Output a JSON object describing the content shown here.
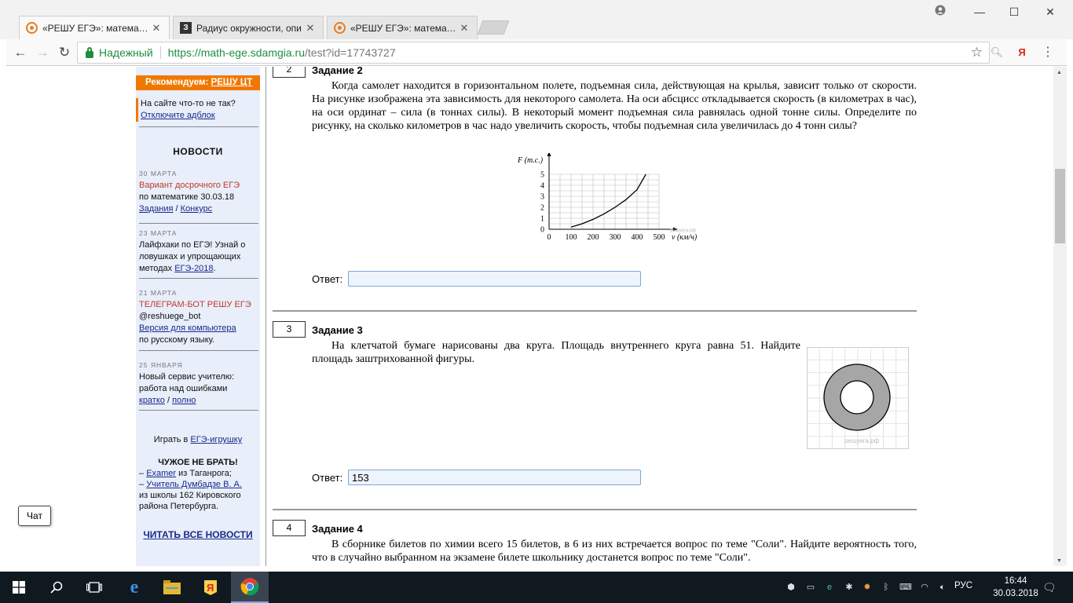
{
  "browser": {
    "tabs": [
      {
        "title": "«РЕШУ ЕГЭ»: математика",
        "favicon": "reshu-ege-icon",
        "active": true
      },
      {
        "title": "Радиус окружности, опи",
        "favicon": "znanija-icon",
        "active": false
      },
      {
        "title": "«РЕШУ ЕГЭ»: математика",
        "favicon": "reshu-ege-icon",
        "active": false
      }
    ],
    "secure_label": "Надежный",
    "url_host": "https://math-ege.sdamgia.ru",
    "url_path": "/test?id=17743727"
  },
  "sidebar": {
    "recommend_prefix": "Рекомендуем:",
    "recommend_link": "РЕШУ ЦТ",
    "problem_text": "На сайте что-то не так?",
    "problem_link": "Отключите адблок",
    "news_title": "НОВОСТИ",
    "news": [
      {
        "date": "30 МАРТА",
        "line1": "Вариант досрочного ЕГЭ",
        "line2": "по математике 30.03.18",
        "link1": "Задания",
        "sep": " / ",
        "link2": "Конкурс"
      },
      {
        "date": "23 МАРТА",
        "line1": "Лайфхаки по ЕГЭ! Узнай о",
        "line2": "ловушках и упрощающих",
        "line3": "методах ",
        "link": "ЕГЭ-2018",
        "end": "."
      },
      {
        "date": "21 МАРТА",
        "line1": "ТЕЛЕГРАМ-БОТ РЕШУ ЕГЭ",
        "line2": "@reshuege_bot",
        "link": "Версия для компьютера",
        "line3": "по русскому языку."
      },
      {
        "date": "25 ЯНВАРЯ",
        "line1": "Новый сервис учителю:",
        "line2": "работа над ошибками",
        "link1": "кратко",
        "sep": " / ",
        "link2": "полно"
      }
    ],
    "play_prefix": "Играть в ",
    "play_link": "ЕГЭ-игрушку",
    "chuzhoe_title": "ЧУЖОЕ НЕ БРАТЬ!",
    "chuzhoe_dash1": "– ",
    "chuzhoe_link1": "Examer",
    "chuzhoe_text1": " из Таганрога;",
    "chuzhoe_dash2": "– ",
    "chuzhoe_link2": "Учитель Думбадзе В. А.",
    "chuzhoe_text2": "из школы 162 Кировского района Петербурга.",
    "read_all": "ЧИТАТЬ ВСЕ НОВОСТИ"
  },
  "tasks": [
    {
      "number": "2",
      "title": "Задание 2",
      "text": "Когда самолет находится в горизонтальном полете, подъемная сила, действующая на крылья, зависит только от скорости. На рисунке изображена эта зависимость для некоторого самолета. На оси абсцисс откладывается скорость (в километрах в час), на оси ординат – сила (в тоннах силы). В некоторый момент подъемная сила равнялась одной тонне силы. Определите по рисунку, на сколько километров в час надо увеличить скорость, чтобы подъемная сила увеличилась до 4 тонн силы?",
      "answer_label": "Ответ:",
      "answer_value": ""
    },
    {
      "number": "3",
      "title": "Задание 3",
      "text": "На клетчатой бумаге нарисованы два круга. Площадь внутреннего круга равна 51. Найдите площадь заштрихованной фигуры.",
      "answer_label": "Ответ:",
      "answer_value": "153",
      "watermark": "решуега.рф"
    },
    {
      "number": "4",
      "title": "Задание 4",
      "text": "В сборнике билетов по химии всего 15 билетов, в 6 из них встречается вопрос по теме \"Соли\". Найдите вероятность того, что в случайно выбранном на экзамене билете школьнику достанется вопрос по теме \"Соли\"."
    }
  ],
  "chart_data": {
    "type": "line",
    "ylabel": "F (т.с.)",
    "xlabel": "v (км/ч)",
    "x_ticks": [
      "0",
      "100",
      "200",
      "300",
      "400",
      "500"
    ],
    "y_ticks": [
      "0",
      "1",
      "2",
      "3",
      "4",
      "5"
    ],
    "xlim": [
      0,
      500
    ],
    "ylim": [
      0,
      5
    ],
    "grid": true,
    "watermark": "решуега.рф",
    "series": [
      {
        "x": [
          100,
          150,
          200,
          250,
          300,
          350,
          400,
          440
        ],
        "y": [
          0.2,
          0.5,
          0.9,
          1.4,
          2.0,
          2.7,
          3.6,
          5.0
        ]
      }
    ]
  },
  "chat_label": "Чат",
  "taskbar": {
    "lang": "РУС",
    "time": "16:44",
    "date": "30.03.2018"
  }
}
